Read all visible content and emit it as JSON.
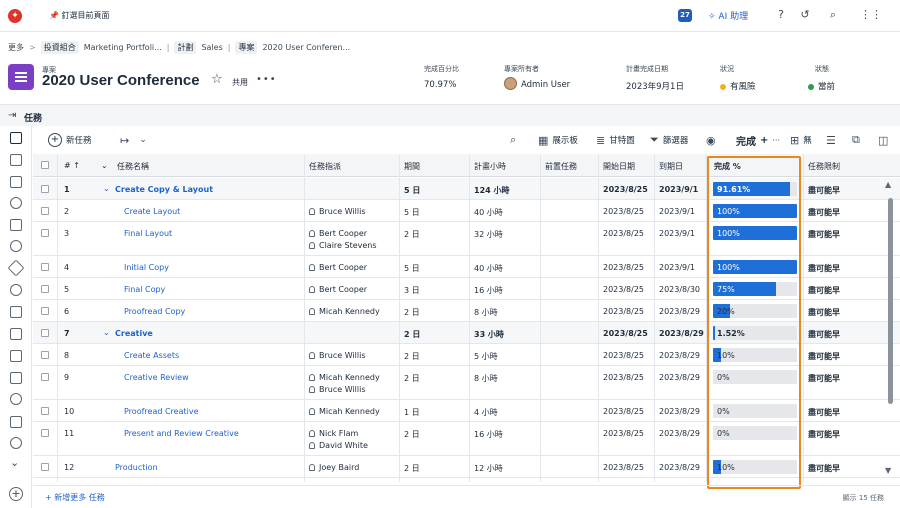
{
  "topbar": {
    "pin_label": "釘選目前頁面",
    "notification_count": "27",
    "ai_label": "AI 助理"
  },
  "breadcrumb": {
    "more": "更多",
    "items": [
      {
        "tag": "投資組合",
        "name": "Marketing Portfoli..."
      },
      {
        "tag": "計劃",
        "name": "Sales"
      },
      {
        "tag": "專案",
        "name": "2020 User Conferen..."
      }
    ]
  },
  "project": {
    "type": "專案",
    "title": "2020 User Conference",
    "share": "共用",
    "more": "•••",
    "meta": [
      {
        "label": "完成百分比",
        "value": "70.97%"
      },
      {
        "label": "專案所有者",
        "value": "Admin User"
      },
      {
        "label": "計畫完成日期",
        "value": "2023年9月1日"
      },
      {
        "label": "狀況",
        "value": "有風險",
        "color": "#f2b21e"
      },
      {
        "label": "狀態",
        "value": "當前",
        "color": "#2e9b4a"
      }
    ]
  },
  "section": {
    "title": "任務"
  },
  "toolbar": {
    "new_task": "新任務",
    "show_as": "展示板",
    "gantt": "甘特圖",
    "filter": "篩選器",
    "complete": "完成",
    "plus": "+",
    "more": "···",
    "grid_label": "無"
  },
  "columns": {
    "num": "#",
    "name": "任務名稱",
    "assign": "任務指派",
    "duration": "期間",
    "planned_hours": "計畫小時",
    "predecessor": "前置任務",
    "start": "開始日期",
    "due": "到期日",
    "complete": "完成 %",
    "constraint": "任務限制"
  },
  "rows": [
    {
      "num": "1",
      "name": "Create Copy & Layout",
      "assign": [],
      "duration": "5 日",
      "hours": "124 小時",
      "start": "2023/8/25",
      "due": "2023/9/1",
      "pct": 91.61,
      "pct_label": "91.61%",
      "constraint": "盡可能早",
      "parent": true
    },
    {
      "num": "2",
      "name": "Create Layout",
      "assign": [
        "Bruce Willis"
      ],
      "duration": "5 日",
      "hours": "40 小時",
      "start": "2023/8/25",
      "due": "2023/9/1",
      "pct": 100,
      "pct_label": "100%",
      "constraint": "盡可能早",
      "parent": false
    },
    {
      "num": "3",
      "name": "Final Layout",
      "assign": [
        "Bert Cooper",
        "Claire Stevens"
      ],
      "duration": "2 日",
      "hours": "32 小時",
      "start": "2023/8/25",
      "due": "2023/9/1",
      "pct": 100,
      "pct_label": "100%",
      "constraint": "盡可能早",
      "parent": false
    },
    {
      "num": "4",
      "name": "Initial Copy",
      "assign": [
        "Bert Cooper"
      ],
      "duration": "5 日",
      "hours": "40 小時",
      "start": "2023/8/25",
      "due": "2023/9/1",
      "pct": 100,
      "pct_label": "100%",
      "constraint": "盡可能早",
      "parent": false
    },
    {
      "num": "5",
      "name": "Final Copy",
      "assign": [
        "Bert Cooper"
      ],
      "duration": "3 日",
      "hours": "16 小時",
      "start": "2023/8/25",
      "due": "2023/8/30",
      "pct": 75,
      "pct_label": "75%",
      "constraint": "盡可能早",
      "parent": false
    },
    {
      "num": "6",
      "name": "Proofread Copy",
      "assign": [
        "Micah Kennedy"
      ],
      "duration": "2 日",
      "hours": "8 小時",
      "start": "2023/8/25",
      "due": "2023/8/29",
      "pct": 20,
      "pct_label": "20%",
      "constraint": "盡可能早",
      "parent": false
    },
    {
      "num": "7",
      "name": "Creative",
      "assign": [],
      "duration": "2 日",
      "hours": "33 小時",
      "start": "2023/8/25",
      "due": "2023/8/29",
      "pct": 1.52,
      "pct_label": "1.52%",
      "constraint": "盡可能早",
      "parent": true
    },
    {
      "num": "8",
      "name": "Create Assets",
      "assign": [
        "Bruce Willis"
      ],
      "duration": "2 日",
      "hours": "5 小時",
      "start": "2023/8/25",
      "due": "2023/8/29",
      "pct": 10,
      "pct_label": "10%",
      "constraint": "盡可能早",
      "parent": false
    },
    {
      "num": "9",
      "name": "Creative Review",
      "assign": [
        "Micah Kennedy",
        "Bruce Willis"
      ],
      "duration": "2 日",
      "hours": "8 小時",
      "start": "2023/8/25",
      "due": "2023/8/29",
      "pct": 0,
      "pct_label": "0%",
      "constraint": "盡可能早",
      "parent": false
    },
    {
      "num": "10",
      "name": "Proofread Creative",
      "assign": [
        "Micah Kennedy"
      ],
      "duration": "1 日",
      "hours": "4 小時",
      "start": "2023/8/25",
      "due": "2023/8/29",
      "pct": 0,
      "pct_label": "0%",
      "constraint": "盡可能早",
      "parent": false
    },
    {
      "num": "11",
      "name": "Present and Review Creative",
      "assign": [
        "Nick Flam",
        "David White"
      ],
      "duration": "2 日",
      "hours": "16 小時",
      "start": "2023/8/25",
      "due": "2023/8/29",
      "pct": 0,
      "pct_label": "0%",
      "constraint": "盡可能早",
      "parent": false
    },
    {
      "num": "12",
      "name": "Production",
      "assign": [
        "Joey Baird"
      ],
      "duration": "2 日",
      "hours": "12 小時",
      "start": "2023/8/25",
      "due": "2023/8/29",
      "pct": 10,
      "pct_label": "10%",
      "constraint": "盡可能早",
      "parent": false
    }
  ],
  "footer": {
    "add_more": "+ 新增更多 任務",
    "showing": "顯示 15 任務"
  }
}
